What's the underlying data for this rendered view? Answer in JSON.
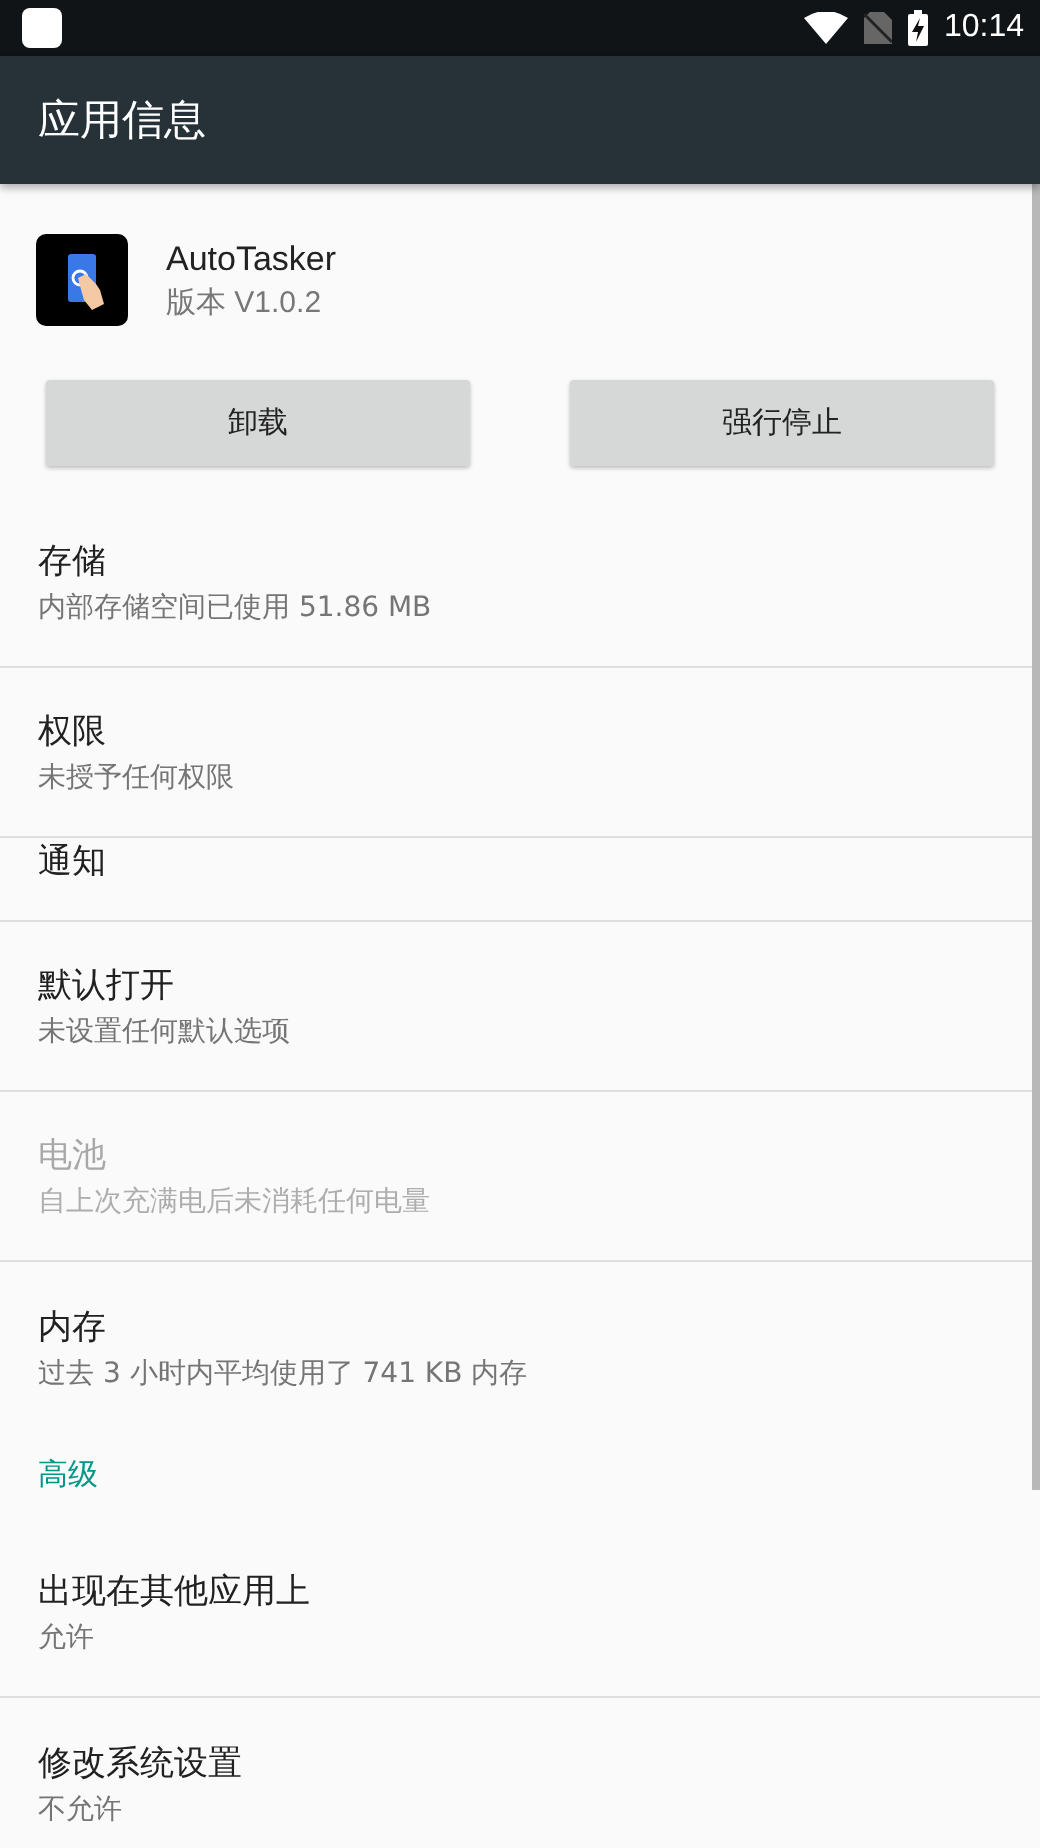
{
  "status_bar": {
    "time": "10:14"
  },
  "app_bar": {
    "title": "应用信息"
  },
  "app": {
    "name": "AutoTasker",
    "version": "版本 V1.0.2"
  },
  "buttons": [
    "卸载",
    "强行停止"
  ],
  "items": [
    {
      "kind": "setting",
      "title": "存储",
      "summary": "内部存储空间已使用 51.86 MB",
      "disabled": false,
      "divider_below": true
    },
    {
      "kind": "setting",
      "title": "权限",
      "summary": "未授予任何权限",
      "disabled": false,
      "divider_below": true
    },
    {
      "kind": "compact",
      "title": "通知",
      "disabled": false,
      "divider_below": true
    },
    {
      "kind": "setting",
      "title": "默认打开",
      "summary": "未设置任何默认选项",
      "disabled": false,
      "divider_below": true
    },
    {
      "kind": "setting",
      "title": "电池",
      "summary": "自上次充满电后未消耗任何电量",
      "disabled": true,
      "divider_below": true
    },
    {
      "kind": "setting",
      "title": "内存",
      "summary": "过去 3 小时内平均使用了 741 KB 内存",
      "disabled": false,
      "divider_below": false
    },
    {
      "kind": "section",
      "title": "高级",
      "divider_below": false
    },
    {
      "kind": "setting",
      "title": "出现在其他应用上",
      "summary": "允许",
      "disabled": false,
      "divider_below": true
    },
    {
      "kind": "setting",
      "title": "修改系统设置",
      "summary": "不允许",
      "disabled": false,
      "divider_below": false
    }
  ]
}
